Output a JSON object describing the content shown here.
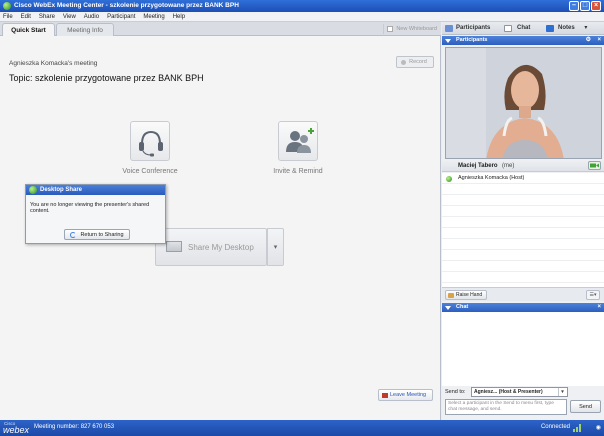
{
  "window": {
    "title": "Cisco WebEx Meeting Center - szkolenie przygotowane przez BANK BPH"
  },
  "menu": [
    "File",
    "Edit",
    "Share",
    "View",
    "Audio",
    "Participant",
    "Meeting",
    "Help"
  ],
  "tabs": {
    "quick_start": "Quick Start",
    "meeting_info": "Meeting Info"
  },
  "toolbar": {
    "new_whiteboard": "New Whiteboard",
    "record": "Record"
  },
  "meeting": {
    "name": "Agnieszka Komacka's meeting",
    "topic_label": "Topic:",
    "topic": "szkolenie przygotowane przez BANK BPH"
  },
  "actions": {
    "voice_conference": "Voice Conference",
    "invite_remind": "Invite & Remind",
    "share_desktop": "Share My Desktop",
    "leave_meeting": "Leave Meeting"
  },
  "popup": {
    "title": "Desktop Share",
    "message": "You are no longer viewing the presenter's shared content.",
    "button": "Return to Sharing"
  },
  "right_tabs": {
    "participants": "Participants",
    "chat": "Chat",
    "notes": "Notes"
  },
  "participants_panel": {
    "header": "Participants",
    "video_name": "Maciej Tabero",
    "video_suffix": "(me)",
    "list": [
      {
        "name": "Agnieszka Komacka (Host)"
      }
    ],
    "raise_hand": "Raise Hand"
  },
  "chat_panel": {
    "header": "Chat",
    "send_to_label": "Send to:",
    "send_to_value": "Agniesz... (Host & Presenter)",
    "input_placeholder": "Select a participant in the Send to menu first, type chat message, and send.",
    "send_button": "Send"
  },
  "status": {
    "logo_top": "Cisco",
    "logo": "webex",
    "meeting_number": "Meeting number: 827 670 053",
    "connection": "Connected",
    "signal_color": "#9fd36a"
  },
  "colors": {
    "title_blue": "#2a5bbd",
    "link_blue": "#2a56b5"
  }
}
